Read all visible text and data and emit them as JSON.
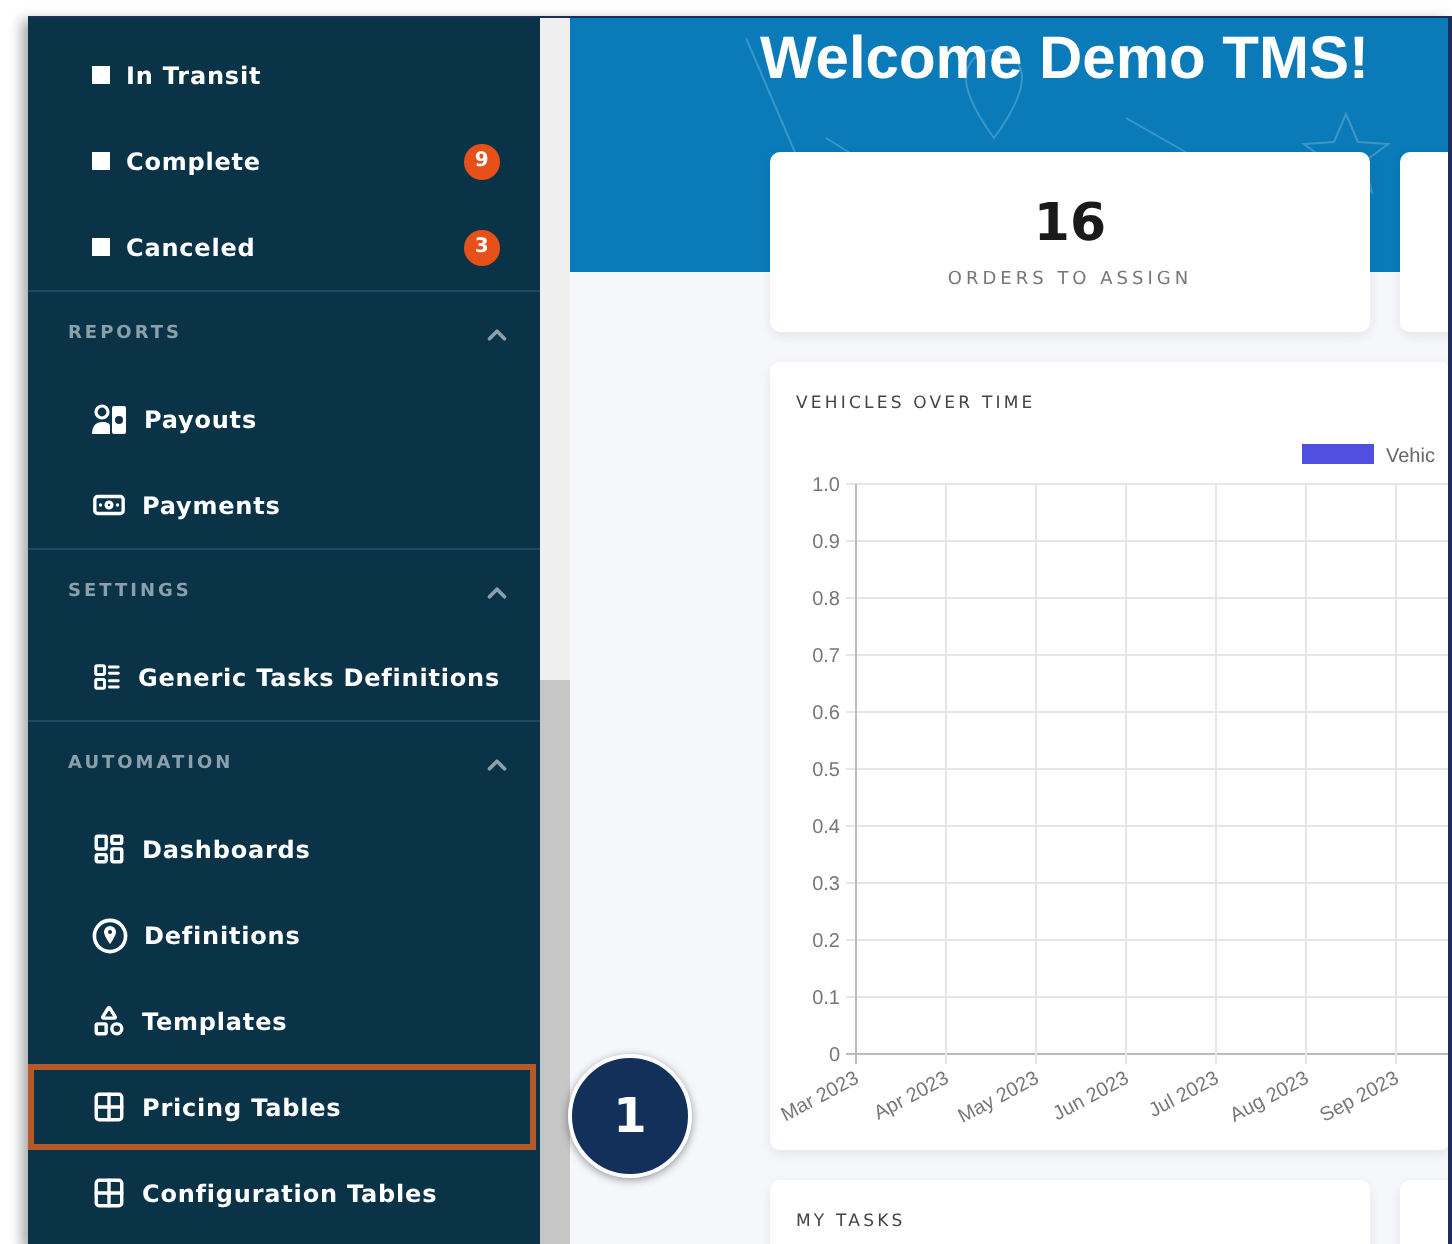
{
  "sidebar": {
    "status_items": [
      {
        "label": "In Transit"
      },
      {
        "label": "Complete",
        "badge": "9"
      },
      {
        "label": "Canceled",
        "badge": "3"
      }
    ],
    "sections": [
      {
        "title": "REPORTS",
        "expanded": true,
        "items": [
          {
            "label": "Payouts",
            "highlighted": false
          },
          {
            "label": "Payments",
            "highlighted": false
          }
        ]
      },
      {
        "title": "SETTINGS",
        "expanded": true,
        "items": [
          {
            "label": "Generic Tasks Definitions",
            "highlighted": false
          }
        ]
      },
      {
        "title": "AUTOMATION",
        "expanded": true,
        "items": [
          {
            "label": "Dashboards",
            "highlighted": false
          },
          {
            "label": "Definitions",
            "highlighted": false
          },
          {
            "label": "Templates",
            "highlighted": false
          },
          {
            "label": "Pricing Tables",
            "highlighted": true
          },
          {
            "label": "Configuration Tables",
            "highlighted": false
          }
        ]
      }
    ]
  },
  "banner": {
    "title": "Welcome Demo TMS!"
  },
  "stats": [
    {
      "value": "16",
      "label": "ORDERS TO ASSIGN"
    }
  ],
  "vehicles_card": {
    "title": "VEHICLES OVER TIME",
    "chart_data": {
      "type": "line",
      "categories": [
        "Mar 2023",
        "Apr 2023",
        "May 2023",
        "Jun 2023",
        "Jul 2023",
        "Aug 2023",
        "Sep 2023"
      ],
      "series": [
        {
          "name": "Vehic",
          "color": "#4f4fe0",
          "values": [
            null,
            null,
            null,
            null,
            null,
            null,
            null
          ]
        }
      ],
      "grid": true,
      "ylim": [
        0,
        1
      ],
      "yticks": [
        {
          "value": 0,
          "label": "0"
        },
        {
          "value": 0.1,
          "label": "0.1"
        },
        {
          "value": 0.2,
          "label": "0.2"
        },
        {
          "value": 0.3,
          "label": "0.3"
        },
        {
          "value": 0.4,
          "label": "0.4"
        },
        {
          "value": 0.5,
          "label": "0.5"
        },
        {
          "value": 0.6,
          "label": "0.6"
        },
        {
          "value": 0.7,
          "label": "0.7"
        },
        {
          "value": 0.8,
          "label": "0.8"
        },
        {
          "value": 0.9,
          "label": "0.9"
        },
        {
          "value": 1,
          "label": "1.0"
        }
      ]
    }
  },
  "tasks_card": {
    "title": "MY TASKS"
  },
  "callout": {
    "label": "1"
  }
}
